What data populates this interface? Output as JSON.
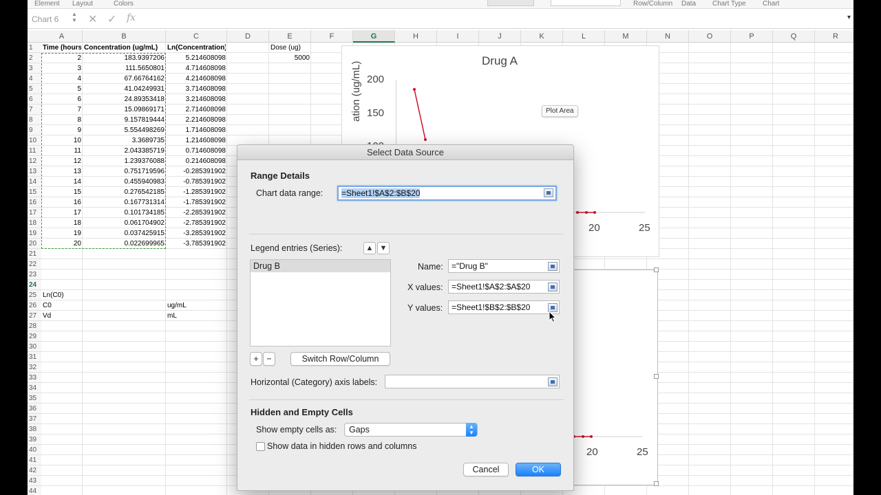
{
  "ribbon": {
    "labels": [
      "Element",
      "Layout",
      "Colors",
      "Row/Column",
      "Data",
      "Chart Type",
      "Chart"
    ]
  },
  "formula_bar": {
    "name_box": "Chart 6",
    "cancel_icon": "close-icon",
    "enter_icon": "check-icon",
    "fx_label": "fx"
  },
  "columns": [
    "A",
    "B",
    "C",
    "D",
    "E",
    "F",
    "G",
    "H",
    "I",
    "J",
    "K",
    "L",
    "M",
    "N",
    "O",
    "P",
    "Q",
    "R"
  ],
  "selected_column": "G",
  "rows": [
    "1",
    "2",
    "3",
    "4",
    "5",
    "6",
    "7",
    "8",
    "9",
    "10",
    "11",
    "12",
    "13",
    "14",
    "15",
    "16",
    "17",
    "18",
    "19",
    "20",
    "21",
    "22",
    "23",
    "24",
    "25",
    "26",
    "27",
    "28",
    "29",
    "30",
    "31",
    "32",
    "33",
    "34",
    "35",
    "36",
    "37",
    "38",
    "39",
    "40",
    "41",
    "42",
    "43",
    "44"
  ],
  "selected_row": "24",
  "sheet": {
    "headers": {
      "a1": "Time (hours)",
      "b1": "Concentration (ug/mL)",
      "c1": "Ln(Concentration)",
      "e1": "Dose (ug)",
      "e2": "5000"
    },
    "time": [
      "2",
      "3",
      "4",
      "5",
      "6",
      "7",
      "8",
      "9",
      "10",
      "11",
      "12",
      "13",
      "14",
      "15",
      "16",
      "17",
      "18",
      "19",
      "20"
    ],
    "concentration": [
      "183.9397206",
      "111.5650801",
      "67.66764162",
      "41.04249931",
      "24.89353418",
      "15.09869171",
      "9.157819444",
      "5.554498269",
      "3.3689735",
      "2.043385719",
      "1.239376088",
      "0.751719596",
      "0.455940983",
      "0.276542185",
      "0.167731314",
      "0.101734185",
      "0.061704902",
      "0.037425915",
      "0.022699965"
    ],
    "ln_concentration": [
      "5.214608098",
      "4.714608098",
      "4.214608098",
      "3.714608098",
      "3.214608098",
      "2.714608098",
      "2.214608098",
      "1.714608098",
      "1.214608098",
      "0.714608098",
      "0.214608098",
      "-0.285391902",
      "-0.785391902",
      "-1.285391902",
      "-1.785391902",
      "-2.285391902",
      "-2.785391902",
      "-3.285391902",
      "-3.785391902"
    ],
    "a25": "Ln(C0)",
    "a26": "C0",
    "c26": "ug/mL",
    "a27": "Vd",
    "c27": "mL"
  },
  "chart_top": {
    "title": "Drug A",
    "ylabel_partial": "ation (ug/mL)",
    "y_ticks": [
      "200",
      "150",
      "100"
    ],
    "x_ticks": [
      "20",
      "25"
    ],
    "tooltip": "Plot Area",
    "series_color": "#d0102a"
  },
  "chart_bottom": {
    "x_ticks": [
      "20",
      "25"
    ],
    "series_color": "#d0102a"
  },
  "chart_data": [
    {
      "type": "scatter",
      "title": "Drug A",
      "ylabel": "ation (ug/mL)",
      "x_ticks": [
        20,
        25
      ],
      "y_ticks": [
        100,
        150,
        200
      ]
    }
  ],
  "dialog": {
    "title": "Select Data Source",
    "range_details_title": "Range Details",
    "chart_data_range_label": "Chart data range:",
    "chart_data_range_value": "=Sheet1!$A$2:$B$20",
    "legend_entries_label": "Legend entries (Series):",
    "series": [
      "Drug B"
    ],
    "name_label": "Name:",
    "name_value": "=\"Drug B\"",
    "x_values_label": "X values:",
    "x_values_value": "=Sheet1!$A$2:$A$20",
    "y_values_label": "Y values:",
    "y_values_value": "=Sheet1!$B$2:$B$20",
    "add_label": "+",
    "remove_label": "−",
    "switch_label": "Switch Row/Column",
    "axis_labels_label": "Horizontal (Category) axis labels:",
    "axis_labels_value": "",
    "hidden_title": "Hidden and Empty Cells",
    "show_empty_label": "Show empty cells as:",
    "show_empty_value": "Gaps",
    "show_hidden_label": "Show data in hidden rows and columns",
    "cancel_label": "Cancel",
    "ok_label": "OK",
    "up_icon": "arrow-up-icon",
    "down_icon": "arrow-down-icon"
  }
}
